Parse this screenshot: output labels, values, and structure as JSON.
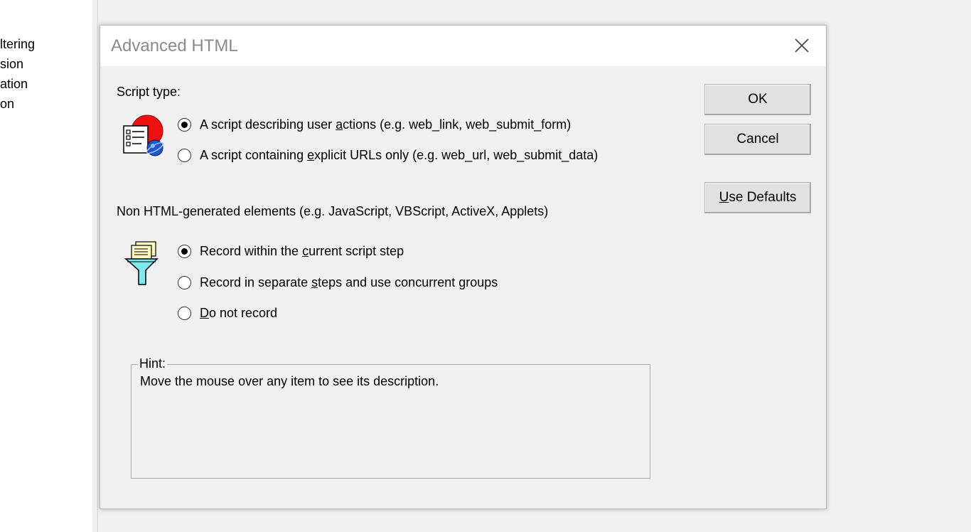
{
  "background": {
    "sidebar_items": [
      "ltering",
      "sion",
      "ation",
      "on"
    ]
  },
  "dialog": {
    "title": "Advanced HTML",
    "close_icon": "close-icon",
    "script_type": {
      "label": "Script type:",
      "icon": "html-script-icon",
      "options": [
        {
          "label": "A script describing user actions (e.g. web_link, web_submit_form)",
          "mnemonic": "a",
          "checked": true
        },
        {
          "label": "A script containing explicit URLs only (e.g. web_url, web_submit_data)",
          "mnemonic": "e",
          "checked": false
        }
      ]
    },
    "non_html": {
      "label": "Non HTML-generated elements (e.g. JavaScript, VBScript, ActiveX, Applets)",
      "icon": "funnel-filter-icon",
      "options": [
        {
          "label": "Record within the current script step",
          "mnemonic": "c",
          "checked": true
        },
        {
          "label": "Record in separate steps and use concurrent groups",
          "mnemonic": "s",
          "checked": false
        },
        {
          "label": "Do not record",
          "mnemonic": "D",
          "checked": false
        }
      ]
    },
    "buttons": {
      "ok": "OK",
      "cancel": "Cancel",
      "use_defaults": "Use Defaults"
    },
    "hint": {
      "title": "Hint:",
      "text": "Move the mouse over any item to see its description."
    }
  }
}
